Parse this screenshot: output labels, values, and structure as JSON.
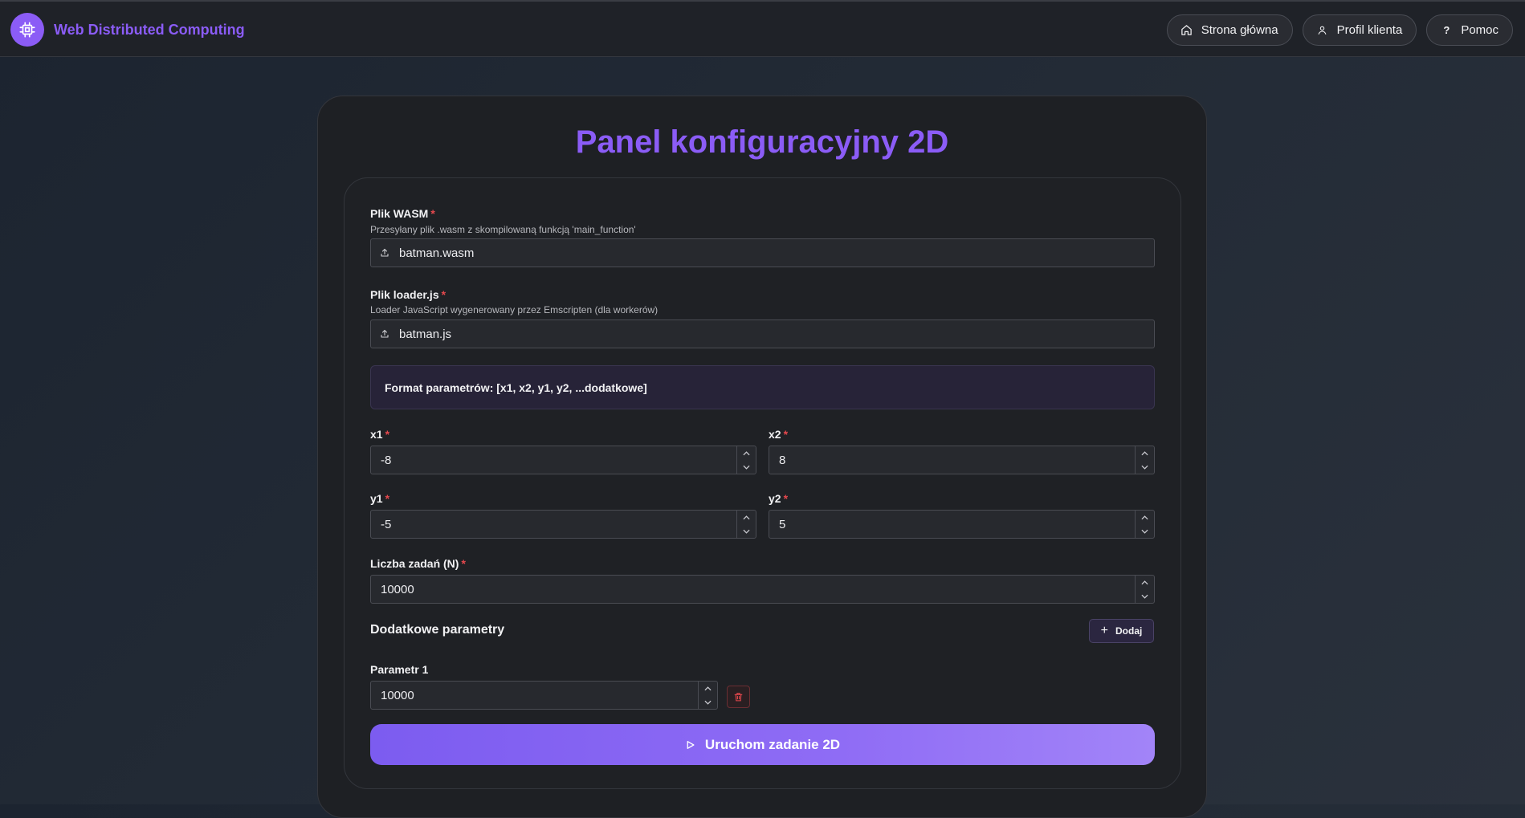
{
  "header": {
    "brand_title": "Web Distributed Computing",
    "nav": [
      {
        "label": "Strona główna",
        "icon": "home-icon"
      },
      {
        "label": "Profil klienta",
        "icon": "user-icon"
      },
      {
        "label": "Pomoc",
        "icon": "help-icon"
      }
    ]
  },
  "panel": {
    "title": "Panel konfiguracyjny 2D",
    "wasm": {
      "label": "Plik WASM",
      "required_mark": "*",
      "help": "Przesyłany plik .wasm z skompilowaną funkcją 'main_function'",
      "value": "batman.wasm"
    },
    "loader": {
      "label": "Plik loader.js",
      "required_mark": "*",
      "help": "Loader JavaScript wygenerowany przez Emscripten (dla workerów)",
      "value": "batman.js"
    },
    "format_info": "Format parametrów: [x1, x2, y1, y2, ...dodatkowe]",
    "x1": {
      "label": "x1",
      "required_mark": "*",
      "value": "-8"
    },
    "x2": {
      "label": "x2",
      "required_mark": "*",
      "value": "8"
    },
    "y1": {
      "label": "y1",
      "required_mark": "*",
      "value": "-5"
    },
    "y2": {
      "label": "y2",
      "required_mark": "*",
      "value": "5"
    },
    "tasks": {
      "label": "Liczba zadań (N)",
      "required_mark": "*",
      "value": "10000"
    },
    "extra": {
      "title": "Dodatkowe parametry",
      "add_label": "Dodaj",
      "params": [
        {
          "label": "Parametr 1",
          "value": "10000"
        }
      ]
    },
    "run_label": "Uruchom zadanie 2D"
  },
  "colors": {
    "accent": "#8b5cf6",
    "danger": "#e5484d",
    "background": "#1e2024"
  }
}
